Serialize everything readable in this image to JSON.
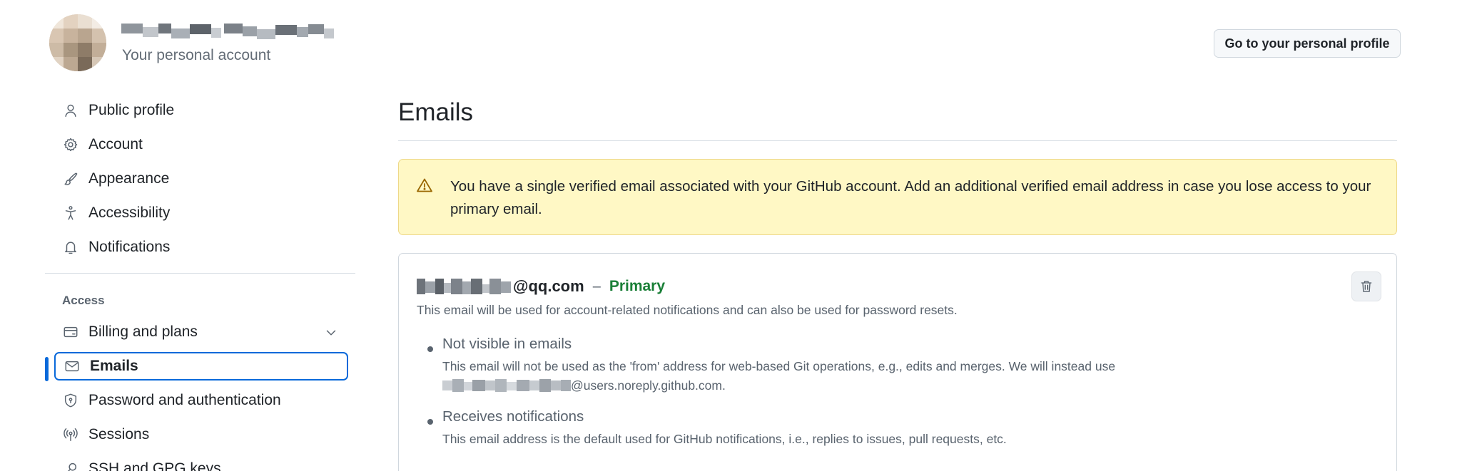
{
  "header": {
    "account_subtitle": "Your personal account",
    "profile_button": "Go to your personal profile"
  },
  "sidebar": {
    "items": [
      {
        "label": "Public profile",
        "icon": "person-icon"
      },
      {
        "label": "Account",
        "icon": "gear-icon"
      },
      {
        "label": "Appearance",
        "icon": "paintbrush-icon"
      },
      {
        "label": "Accessibility",
        "icon": "accessibility-icon"
      },
      {
        "label": "Notifications",
        "icon": "bell-icon"
      }
    ],
    "access_heading": "Access",
    "access_items": [
      {
        "label": "Billing and plans",
        "icon": "credit-card-icon"
      },
      {
        "label": "Emails",
        "icon": "mail-icon",
        "active": true
      },
      {
        "label": "Password and authentication",
        "icon": "shield-lock-icon"
      },
      {
        "label": "Sessions",
        "icon": "broadcast-icon"
      },
      {
        "label": "SSH and GPG keys",
        "icon": "key-icon"
      }
    ]
  },
  "main": {
    "title": "Emails",
    "flash_message": "You have a single verified email associated with your GitHub account. Add an additional verified email address in case you lose access to your primary email.",
    "email": {
      "address_suffix": "@qq.com",
      "separator": "–",
      "badge": "Primary",
      "description": "This email will be used for account-related notifications and can also be used for password resets.",
      "bullets": [
        {
          "title": "Not visible in emails",
          "desc_line1": "This email will not be used as the 'from' address for web-based Git operations, e.g., edits and merges. We will instead use",
          "desc_line2_suffix": "@users.noreply.github.com."
        },
        {
          "title": "Receives notifications",
          "desc_line1": "This email address is the default used for GitHub notifications, i.e., replies to issues, pull requests, etc."
        }
      ]
    }
  },
  "colors": {
    "accent": "#0969da",
    "primary_badge": "#1a7f37",
    "flash_bg": "#fff8c5",
    "warning_icon": "#9a6700"
  }
}
